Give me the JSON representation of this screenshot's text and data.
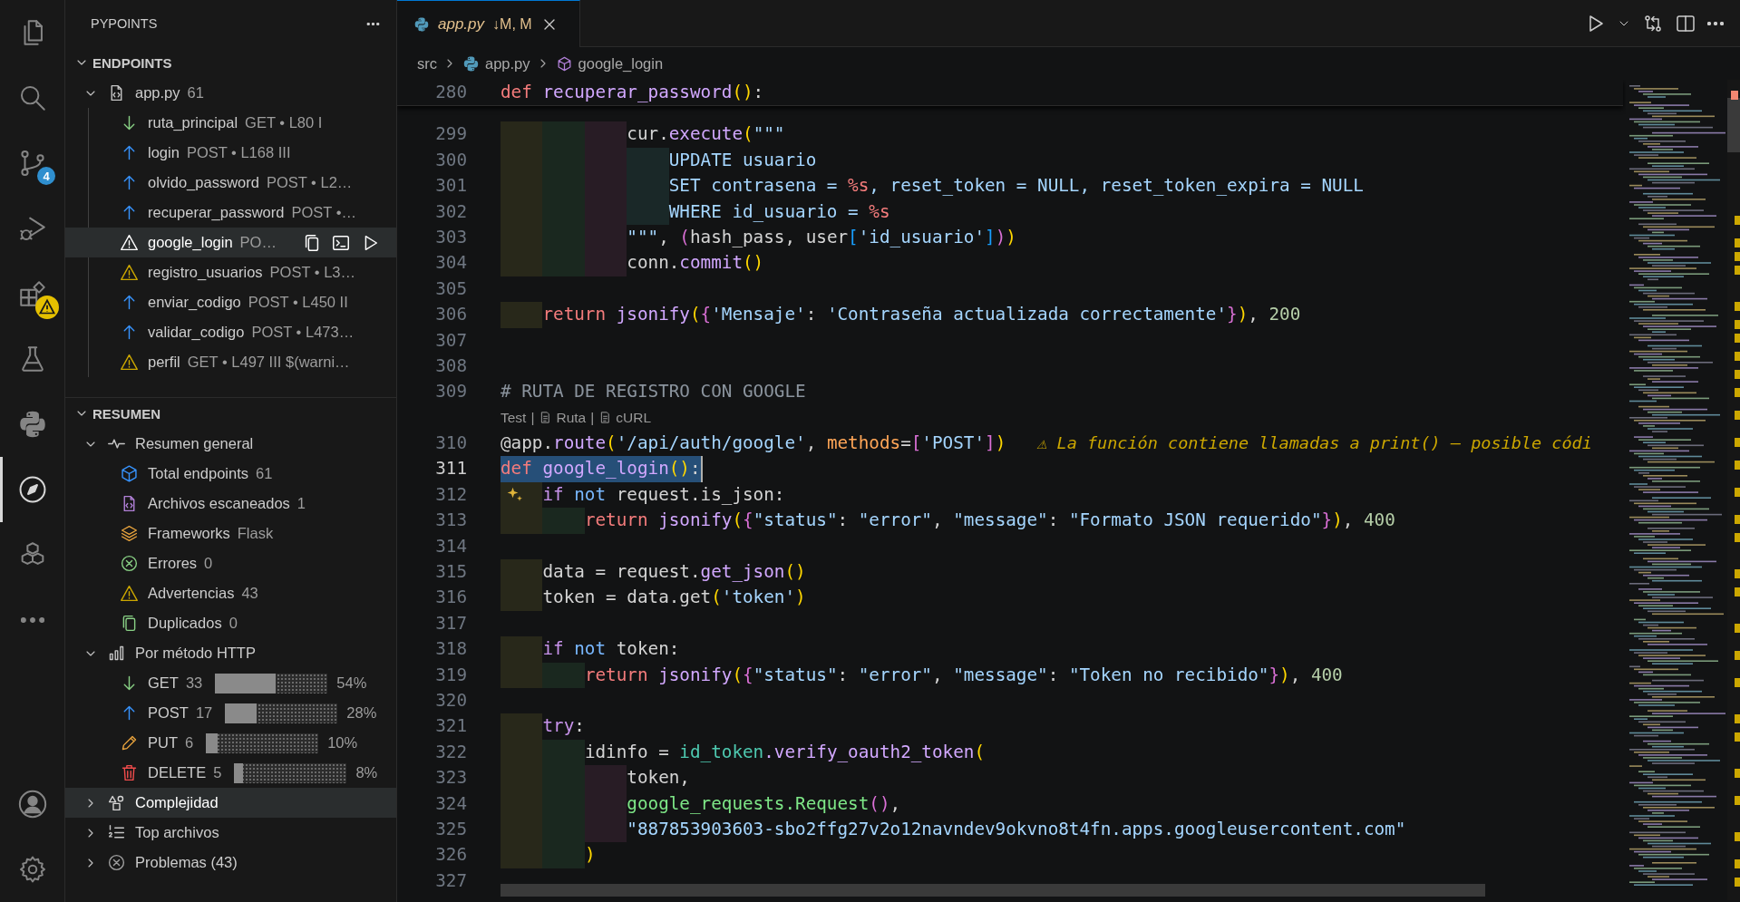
{
  "activity_bar": {
    "items": [
      {
        "kind": "files",
        "selected": false
      },
      {
        "kind": "search",
        "selected": false
      },
      {
        "kind": "source-control",
        "selected": false,
        "badge": "4"
      },
      {
        "kind": "debug",
        "selected": false
      },
      {
        "kind": "extensions",
        "selected": false,
        "warning": true
      },
      {
        "kind": "testing",
        "selected": false
      },
      {
        "kind": "python",
        "selected": false
      },
      {
        "kind": "compass",
        "selected": true
      },
      {
        "kind": "cubes",
        "selected": false
      },
      {
        "kind": "more",
        "selected": false
      }
    ],
    "bottom": [
      {
        "kind": "account",
        "selected": false
      },
      {
        "kind": "settings",
        "selected": false
      }
    ]
  },
  "sidebar": {
    "title": "PYPOINTS",
    "sections": [
      {
        "title": "ENDPOINTS",
        "expanded": true,
        "items": [
          {
            "kind": "file",
            "label": "app.py",
            "detail": "61",
            "expanded": true,
            "selected": false,
            "children": [
              {
                "kind": "get",
                "label": "ruta_principal",
                "detail": "GET • L80 I",
                "selected": false
              },
              {
                "kind": "post",
                "label": "login",
                "detail": "POST • L168 III",
                "selected": false
              },
              {
                "kind": "post",
                "label": "olvido_password",
                "detail": "POST • L2…",
                "selected": false
              },
              {
                "kind": "post",
                "label": "recuperar_password",
                "detail": "POST •…",
                "selected": false
              },
              {
                "kind": "warning",
                "label": "google_login",
                "detail": "PO…",
                "selected": true
              },
              {
                "kind": "warning",
                "label": "registro_usuarios",
                "detail": "POST • L3…",
                "selected": false
              },
              {
                "kind": "post",
                "label": "enviar_codigo",
                "detail": "POST • L450 II",
                "selected": false
              },
              {
                "kind": "post",
                "label": "validar_codigo",
                "detail": "POST • L473…",
                "selected": false
              },
              {
                "kind": "warning",
                "label": "perfil",
                "detail": "GET • L497 III $(warni…",
                "selected": false
              }
            ]
          }
        ]
      },
      {
        "title": "RESUMEN",
        "expanded": true,
        "items": [
          {
            "kind": "pulse",
            "label": "Resumen general",
            "expanded": true,
            "selected": false,
            "children": [
              {
                "kind": "cube",
                "label": "Total endpoints",
                "detail": "61",
                "selected": false
              },
              {
                "kind": "scanned",
                "label": "Archivos escaneados",
                "detail": "1",
                "selected": false
              },
              {
                "kind": "layers",
                "label": "Frameworks",
                "detail": "Flask",
                "selected": false
              },
              {
                "kind": "error",
                "label": "Errores",
                "detail": "0",
                "selected": false
              },
              {
                "kind": "warning",
                "label": "Advertencias",
                "detail": "43",
                "selected": false
              },
              {
                "kind": "duplicate",
                "label": "Duplicados",
                "detail": "0",
                "selected": false
              }
            ]
          },
          {
            "kind": "bar-chart",
            "label": "Por método HTTP",
            "expanded": true,
            "selected": false,
            "children": [
              {
                "kind": "get",
                "label": "GET",
                "detail": "33",
                "level": 0.54,
                "percent": "54%",
                "selected": false
              },
              {
                "kind": "post",
                "label": "POST",
                "detail": "17",
                "level": 0.28,
                "percent": "28%",
                "selected": false
              },
              {
                "kind": "put",
                "label": "PUT",
                "detail": "6",
                "level": 0.1,
                "percent": "10%",
                "selected": false
              },
              {
                "kind": "delete",
                "label": "DELETE",
                "detail": "5",
                "level": 0.08,
                "percent": "8%",
                "selected": false
              }
            ]
          },
          {
            "kind": "shapes",
            "label": "Complejidad",
            "expanded": false,
            "selected": true
          },
          {
            "kind": "numbered-list",
            "label": "Top archivos",
            "expanded": false,
            "selected": false
          },
          {
            "kind": "problems",
            "label": "Problemas (43)",
            "expanded": false,
            "selected": false
          }
        ]
      }
    ]
  },
  "editor": {
    "tab": {
      "label": "app.py",
      "status": "↓M, M",
      "selected": true
    },
    "actions": [
      {
        "kind": "run"
      },
      {
        "kind": "dropdown"
      },
      {
        "kind": "compare"
      },
      {
        "kind": "split"
      },
      {
        "kind": "more"
      }
    ],
    "breadcrumbs": [
      {
        "kind": "folder",
        "label": "src"
      },
      {
        "kind": "python",
        "label": "app.py"
      },
      {
        "kind": "symbol",
        "label": "google_login"
      }
    ],
    "sticky_line": {
      "number": "280",
      "tokens": [
        {
          "kind": "kw",
          "text": "def"
        },
        {
          "kind": "fn",
          "text": " recuperar_password"
        },
        {
          "kind": "p1",
          "text": "()"
        },
        {
          "kind": "plain",
          "text": ":"
        }
      ]
    },
    "lines": [
      {
        "kind": "code",
        "number": "299",
        "selected": false,
        "tokens": [
          {
            "kind": "plain",
            "text": "            cur."
          },
          {
            "kind": "fn",
            "text": "execute"
          },
          {
            "kind": "p1",
            "text": "("
          },
          {
            "kind": "str",
            "text": "\"\"\""
          }
        ]
      },
      {
        "kind": "code",
        "number": "300",
        "selected": false,
        "tokens": [
          {
            "kind": "str",
            "text": "                UPDATE usuario"
          }
        ]
      },
      {
        "kind": "code",
        "number": "301",
        "selected": false,
        "tokens": [
          {
            "kind": "str",
            "text": "                SET contrasena = "
          },
          {
            "kind": "fmt",
            "text": "%s"
          },
          {
            "kind": "str",
            "text": ", reset_token = NULL, reset_token_expira = NULL"
          }
        ]
      },
      {
        "kind": "code",
        "number": "302",
        "selected": false,
        "tokens": [
          {
            "kind": "str",
            "text": "                WHERE id_usuario = "
          },
          {
            "kind": "fmt",
            "text": "%s"
          }
        ]
      },
      {
        "kind": "code",
        "number": "303",
        "selected": false,
        "tokens": [
          {
            "kind": "str",
            "text": "            \"\"\""
          },
          {
            "kind": "plain",
            "text": ", "
          },
          {
            "kind": "p2",
            "text": "("
          },
          {
            "kind": "plain",
            "text": "hash_pass, user"
          },
          {
            "kind": "p3",
            "text": "["
          },
          {
            "kind": "str",
            "text": "'id_usuario'"
          },
          {
            "kind": "p3",
            "text": "]"
          },
          {
            "kind": "p2",
            "text": ")"
          },
          {
            "kind": "p1",
            "text": ")"
          }
        ]
      },
      {
        "kind": "code",
        "number": "304",
        "selected": false,
        "tokens": [
          {
            "kind": "plain",
            "text": "            conn."
          },
          {
            "kind": "fn",
            "text": "commit"
          },
          {
            "kind": "p1",
            "text": "()"
          }
        ]
      },
      {
        "kind": "code",
        "number": "305",
        "selected": false
      },
      {
        "kind": "code",
        "number": "306",
        "selected": false,
        "tokens": [
          {
            "kind": "kw",
            "text": "    return"
          },
          {
            "kind": "fn",
            "text": " jsonify"
          },
          {
            "kind": "p1",
            "text": "("
          },
          {
            "kind": "p2",
            "text": "{"
          },
          {
            "kind": "str",
            "text": "'Mensaje'"
          },
          {
            "kind": "plain",
            "text": ": "
          },
          {
            "kind": "str",
            "text": "'Contraseña actualizada correctamente'"
          },
          {
            "kind": "p2",
            "text": "}"
          },
          {
            "kind": "p1",
            "text": ")"
          },
          {
            "kind": "plain",
            "text": ", "
          },
          {
            "kind": "num",
            "text": "200"
          }
        ]
      },
      {
        "kind": "code",
        "number": "307",
        "selected": false
      },
      {
        "kind": "code",
        "number": "308",
        "selected": false
      },
      {
        "kind": "code",
        "number": "309",
        "selected": false,
        "tokens": [
          {
            "kind": "cm",
            "text": "# RUTA DE REGISTRO CON GOOGLE"
          }
        ]
      },
      {
        "kind": "codelens",
        "items": [
          {
            "kind": "link",
            "label": "Test"
          },
          {
            "kind": "separator",
            "label": "|"
          },
          {
            "kind": "doc",
            "label": "Ruta"
          },
          {
            "kind": "separator",
            "label": "|"
          },
          {
            "kind": "doc",
            "label": "cURL"
          }
        ]
      },
      {
        "kind": "code",
        "number": "310",
        "selected": false,
        "tokens": [
          {
            "kind": "plain",
            "text": "@app."
          },
          {
            "kind": "fn",
            "text": "route"
          },
          {
            "kind": "p1",
            "text": "("
          },
          {
            "kind": "str",
            "text": "'/api/auth/google'"
          },
          {
            "kind": "plain",
            "text": ", "
          },
          {
            "kind": "param",
            "text": "methods"
          },
          {
            "kind": "plain",
            "text": "="
          },
          {
            "kind": "p2",
            "text": "["
          },
          {
            "kind": "str",
            "text": "'POST'"
          },
          {
            "kind": "p2",
            "text": "]"
          },
          {
            "kind": "p1",
            "text": ")"
          }
        ],
        "hint": "⚠ La función contiene llamadas a print() — posible códi"
      },
      {
        "kind": "code",
        "number": "311",
        "selected": true,
        "tokens": [
          {
            "kind": "kw",
            "text": "def"
          },
          {
            "kind": "fn",
            "text": " google_login"
          },
          {
            "kind": "p1",
            "text": "()"
          },
          {
            "kind": "plain",
            "text": ":"
          }
        ]
      },
      {
        "kind": "code",
        "number": "312",
        "selected": false,
        "sparkle": true,
        "tokens": [
          {
            "kind": "ctl",
            "text": "    if"
          },
          {
            "kind": "not",
            "text": " not"
          },
          {
            "kind": "plain",
            "text": " request.is_json:"
          }
        ]
      },
      {
        "kind": "code",
        "number": "313",
        "selected": false,
        "tokens": [
          {
            "kind": "kw",
            "text": "        return"
          },
          {
            "kind": "fn",
            "text": " jsonify"
          },
          {
            "kind": "p1",
            "text": "("
          },
          {
            "kind": "p2",
            "text": "{"
          },
          {
            "kind": "str",
            "text": "\"status\""
          },
          {
            "kind": "plain",
            "text": ": "
          },
          {
            "kind": "str",
            "text": "\"error\""
          },
          {
            "kind": "plain",
            "text": ", "
          },
          {
            "kind": "str",
            "text": "\"message\""
          },
          {
            "kind": "plain",
            "text": ": "
          },
          {
            "kind": "str",
            "text": "\"Formato JSON requerido\""
          },
          {
            "kind": "p2",
            "text": "}"
          },
          {
            "kind": "p1",
            "text": ")"
          },
          {
            "kind": "plain",
            "text": ", "
          },
          {
            "kind": "num",
            "text": "400"
          }
        ]
      },
      {
        "kind": "code",
        "number": "314",
        "selected": false
      },
      {
        "kind": "code",
        "number": "315",
        "selected": false,
        "tokens": [
          {
            "kind": "plain",
            "text": "    data = request."
          },
          {
            "kind": "fn",
            "text": "get_json"
          },
          {
            "kind": "p1",
            "text": "()"
          }
        ]
      },
      {
        "kind": "code",
        "number": "316",
        "selected": false,
        "tokens": [
          {
            "kind": "plain",
            "text": "    token = data.get"
          },
          {
            "kind": "p1",
            "text": "("
          },
          {
            "kind": "str",
            "text": "'token'"
          },
          {
            "kind": "p1",
            "text": ")"
          }
        ]
      },
      {
        "kind": "code",
        "number": "317",
        "selected": false
      },
      {
        "kind": "code",
        "number": "318",
        "selected": false,
        "tokens": [
          {
            "kind": "ctl",
            "text": "    if"
          },
          {
            "kind": "not",
            "text": " not"
          },
          {
            "kind": "plain",
            "text": " token:"
          }
        ]
      },
      {
        "kind": "code",
        "number": "319",
        "selected": false,
        "tokens": [
          {
            "kind": "kw",
            "text": "        return"
          },
          {
            "kind": "fn",
            "text": " jsonify"
          },
          {
            "kind": "p1",
            "text": "("
          },
          {
            "kind": "p2",
            "text": "{"
          },
          {
            "kind": "str",
            "text": "\"status\""
          },
          {
            "kind": "plain",
            "text": ": "
          },
          {
            "kind": "str",
            "text": "\"error\""
          },
          {
            "kind": "plain",
            "text": ", "
          },
          {
            "kind": "str",
            "text": "\"message\""
          },
          {
            "kind": "plain",
            "text": ": "
          },
          {
            "kind": "str",
            "text": "\"Token no recibido\""
          },
          {
            "kind": "p2",
            "text": "}"
          },
          {
            "kind": "p1",
            "text": ")"
          },
          {
            "kind": "plain",
            "text": ", "
          },
          {
            "kind": "num",
            "text": "400"
          }
        ]
      },
      {
        "kind": "code",
        "number": "320",
        "selected": false
      },
      {
        "kind": "code",
        "number": "321",
        "selected": false,
        "tokens": [
          {
            "kind": "ctl",
            "text": "    try"
          },
          {
            "kind": "plain",
            "text": ":"
          }
        ]
      },
      {
        "kind": "code",
        "number": "322",
        "selected": false,
        "tokens": [
          {
            "kind": "plain",
            "text": "        idinfo = "
          },
          {
            "kind": "cls",
            "text": "id_token"
          },
          {
            "kind": "fn",
            "text": ".verify_oauth2_token"
          },
          {
            "kind": "p1",
            "text": "("
          }
        ]
      },
      {
        "kind": "code",
        "number": "323",
        "selected": false,
        "tokens": [
          {
            "kind": "plain",
            "text": "            token,"
          }
        ]
      },
      {
        "kind": "code",
        "number": "324",
        "selected": false,
        "tokens": [
          {
            "kind": "cls2",
            "text": "            google_requests"
          },
          {
            "kind": "cls2",
            "text": ".Request"
          },
          {
            "kind": "p2",
            "text": "()"
          },
          {
            "kind": "plain",
            "text": ","
          }
        ]
      },
      {
        "kind": "code",
        "number": "325",
        "selected": false,
        "tokens": [
          {
            "kind": "str",
            "text": "            \"887853903603-sbo2ffg27v2o12navndev9okvno8t4fn.apps.googleusercontent.com\""
          }
        ]
      },
      {
        "kind": "code",
        "number": "326",
        "selected": false,
        "tokens": [
          {
            "kind": "p1",
            "text": "        )"
          }
        ]
      },
      {
        "kind": "code",
        "number": "327",
        "selected": false
      }
    ]
  }
}
